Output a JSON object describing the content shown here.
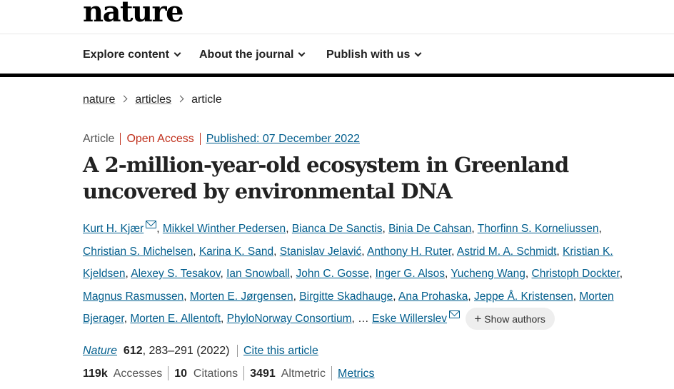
{
  "header": {
    "logo": "nature"
  },
  "nav": {
    "items": [
      {
        "label": "Explore content"
      },
      {
        "label": "About the journal"
      },
      {
        "label": "Publish with us"
      }
    ]
  },
  "breadcrumb": {
    "items": [
      "nature",
      "articles"
    ],
    "current": "article"
  },
  "meta": {
    "type": "Article",
    "access": "Open Access",
    "published": "Published: 07 December 2022"
  },
  "title": "A 2-million-year-old ecosystem in Greenland uncovered by environmental DNA",
  "authors": [
    "Kurt H. Kjær",
    "Mikkel Winther Pedersen",
    "Bianca De Sanctis",
    "Binia De Cahsan",
    "Thorfinn S. Korneliussen",
    "Christian S. Michelsen",
    "Karina K. Sand",
    "Stanislav Jelavić",
    "Anthony H. Ruter",
    "Astrid M. A. Schmidt",
    "Kristian K. Kjeldsen",
    "Alexey S. Tesakov",
    "Ian Snowball",
    "John C. Gosse",
    "Inger G. Alsos",
    "Yucheng Wang",
    "Christoph Dockter",
    "Magnus Rasmussen",
    "Morten E. Jørgensen",
    "Birgitte Skadhauge",
    "Ana Prohaska",
    "Jeppe Å. Kristensen",
    "Morten Bjerager",
    "Morten E. Allentoft",
    "PhyloNorway Consortium",
    "Eske Willerslev"
  ],
  "authors_ellipsis": "…",
  "show_authors_label": "Show authors",
  "citation": {
    "journal": "Nature",
    "volume": "612",
    "pages": ", 283–291 (2022)",
    "cite_label": "Cite this article"
  },
  "metrics": {
    "accesses_value": "119k",
    "accesses_label": "Accesses",
    "citations_value": "10",
    "citations_label": "Citations",
    "altmetric_value": "3491",
    "altmetric_label": "Altmetric",
    "metrics_link": "Metrics"
  },
  "colors": {
    "link": "#025e8d",
    "open_access": "#c0301c",
    "rule": "#000000"
  }
}
